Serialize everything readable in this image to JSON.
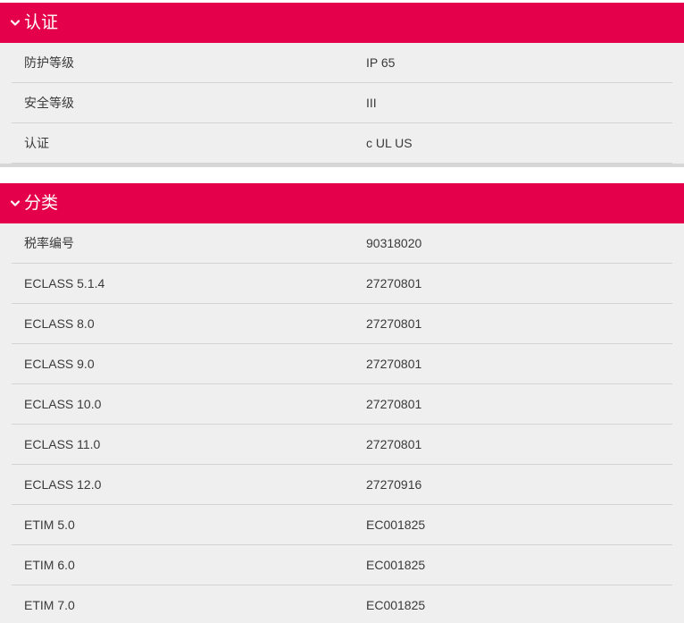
{
  "sections": [
    {
      "title": "认证",
      "rows": [
        {
          "label": "防护等级",
          "value": "IP 65"
        },
        {
          "label": "安全等级",
          "value": "III"
        },
        {
          "label": "认证",
          "value": "c UL US"
        }
      ]
    },
    {
      "title": "分类",
      "rows": [
        {
          "label": "税率编号",
          "value": "90318020"
        },
        {
          "label": "ECLASS 5.1.4",
          "value": "27270801"
        },
        {
          "label": "ECLASS 8.0",
          "value": "27270801"
        },
        {
          "label": "ECLASS 9.0",
          "value": "27270801"
        },
        {
          "label": "ECLASS 10.0",
          "value": "27270801"
        },
        {
          "label": "ECLASS 11.0",
          "value": "27270801"
        },
        {
          "label": "ECLASS 12.0",
          "value": "27270916"
        },
        {
          "label": "ETIM 5.0",
          "value": "EC001825"
        },
        {
          "label": "ETIM 6.0",
          "value": "EC001825"
        },
        {
          "label": "ETIM 7.0",
          "value": "EC001825"
        }
      ]
    }
  ],
  "colors": {
    "header_bg": "#e4004a",
    "header_text": "#ffffff",
    "panel_bg": "#efefef",
    "row_divider": "#d4d4d4",
    "text": "#3a3a3a"
  },
  "icons": {
    "section_toggle": "chevron-down-icon"
  }
}
